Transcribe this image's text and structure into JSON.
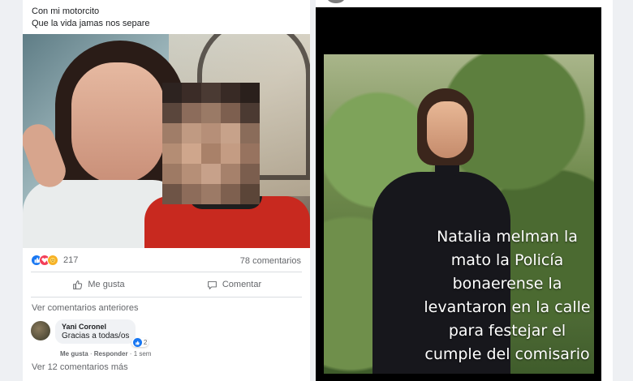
{
  "post": {
    "caption_line1": "Con mi motorcito",
    "caption_line2": "Que la vida jamas nos separe",
    "reactions": {
      "icons": [
        "like-icon",
        "love-icon",
        "care-icon"
      ],
      "count": "217"
    },
    "comments_count": "78 comentarios",
    "actions": {
      "like_label": "Me gusta",
      "comment_label": "Comentar"
    },
    "prev_comments_label": "Ver comentarios anteriores",
    "comment": {
      "author": "Yani Coronel",
      "text": "Gracias a todas/os",
      "like_count": "2",
      "meta_like": "Me gusta",
      "meta_sep1": " · ",
      "meta_reply": "Responder",
      "meta_sep2": " · ",
      "meta_time": "1 sem"
    },
    "more_comments_label": "Ver 12 comentarios más"
  },
  "story": {
    "text": "Natalia melman la mato la Policía bonaerense la levantaron en la calle para festejar el cumple del comisario"
  },
  "colors": {
    "fb_blue": "#1877f2",
    "love_red": "#f33e58",
    "care_yellow": "#f7b125",
    "muted_text": "#65676b"
  }
}
